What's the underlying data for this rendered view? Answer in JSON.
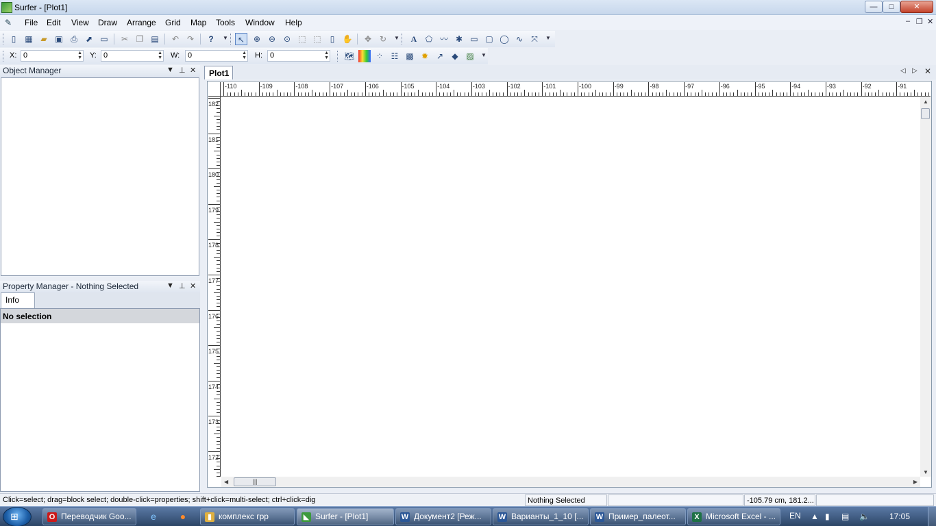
{
  "window": {
    "title": "Surfer - [Plot1]",
    "minimize_label": "—",
    "maximize_label": "□",
    "close_label": "✕"
  },
  "menu": {
    "items": [
      "File",
      "Edit",
      "View",
      "Draw",
      "Arrange",
      "Grid",
      "Map",
      "Tools",
      "Window",
      "Help"
    ],
    "mdi_min": "–",
    "mdi_restore": "❐",
    "mdi_close": "✕"
  },
  "toolbar1_icons": [
    "new-plot-icon",
    "new-worksheet-icon",
    "open-icon",
    "save-icon",
    "print-icon",
    "export-icon",
    "page-setup-icon",
    "cut-icon",
    "copy-icon",
    "paste-icon",
    "undo-icon",
    "redo-icon",
    "help-icon",
    "select-icon",
    "zoom-in-icon",
    "zoom-out-icon",
    "zoom-rectangle-icon",
    "zoom-page-icon",
    "zoom-fit-icon",
    "zoom-selected-icon",
    "pan-icon",
    "trackball-icon",
    "rotate-icon",
    "text-icon",
    "polygon-icon",
    "polyline-icon",
    "symbol-icon",
    "rectangle-icon",
    "rounded-rectangle-icon",
    "ellipse-icon",
    "spline-icon",
    "reshape-icon"
  ],
  "position_fields": {
    "x": {
      "label": "X:",
      "value": "0"
    },
    "y": {
      "label": "Y:",
      "value": "0"
    },
    "w": {
      "label": "W:",
      "value": "0"
    },
    "h": {
      "label": "H:",
      "value": "0"
    }
  },
  "toolbar2_icons": [
    "base-map-icon",
    "image-map-icon",
    "post-map-icon",
    "classed-post-icon",
    "3d-surface-icon",
    "shaded-relief-icon",
    "vector-map-icon",
    "3d-wireframe-icon",
    "color-relief-icon"
  ],
  "object_manager": {
    "title": "Object Manager"
  },
  "property_manager": {
    "title": "Property Manager - Nothing Selected",
    "tab": "Info",
    "empty_text": "No selection"
  },
  "document": {
    "tab": "Plot1"
  },
  "rulers": {
    "horizontal": [
      "-110",
      "-109",
      "-108",
      "-107",
      "-106",
      "-105",
      "-104",
      "-103",
      "-102",
      "-101",
      "-100",
      "-99",
      "-98",
      "-97",
      "-96",
      "-95",
      "-94",
      "-93",
      "-92",
      "-91"
    ],
    "vertical": [
      "182",
      "181",
      "180",
      "179",
      "178",
      "177",
      "176",
      "175",
      "174",
      "173",
      "172"
    ]
  },
  "status": {
    "hint": "Click=select; drag=block select; double-click=properties; shift+click=multi-select; ctrl+click=dig",
    "selection": "Nothing Selected",
    "blank": "",
    "coords": "-105.79 cm, 181.2..."
  },
  "taskbar": {
    "tasks": [
      {
        "label": "Переводчик Goo...",
        "icon": "opera-icon",
        "color": "#cc1a1a"
      },
      {
        "label": "комплекс грр",
        "icon": "folder-icon",
        "color": "#e0b040"
      },
      {
        "label": "Surfer - [Plot1]",
        "icon": "surfer-icon",
        "color": "#3c9a3c"
      },
      {
        "label": "Документ2 [Реж...",
        "icon": "word-icon",
        "color": "#2b5797"
      },
      {
        "label": "Варианты_1_10 [...",
        "icon": "word-icon",
        "color": "#2b5797"
      },
      {
        "label": "Пример_палеот...",
        "icon": "word-icon",
        "color": "#2b5797"
      },
      {
        "label": "Microsoft Excel - ...",
        "icon": "excel-icon",
        "color": "#1e7145"
      }
    ],
    "lang": "EN",
    "clock": "17:05"
  }
}
